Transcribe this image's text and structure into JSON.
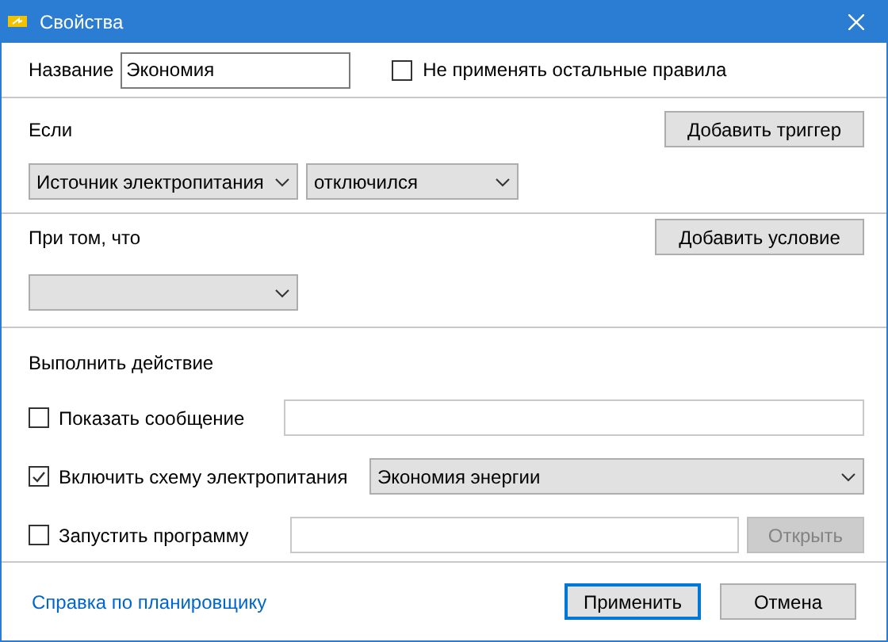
{
  "window": {
    "title": "Свойства"
  },
  "name_row": {
    "label": "Название",
    "value": "Экономия",
    "stop_rule": {
      "label": "Не применять остальные правила",
      "checked": false
    }
  },
  "trigger": {
    "heading": "Если",
    "button": "Добавить триггер",
    "selects": [
      "Источник электропитания",
      "отключился"
    ]
  },
  "condition": {
    "heading": "При том, что",
    "button": "Добавить условие"
  },
  "actions": {
    "heading": "Выполнить действие",
    "items": [
      {
        "kind": "message",
        "label": "Показать сообщение",
        "checked": false
      },
      {
        "kind": "scheme",
        "label": "Включить схему электропитания",
        "checked": true,
        "value": "Экономия энергии"
      },
      {
        "kind": "program",
        "label": "Запустить программу",
        "checked": false,
        "button": {
          "label": "Открыть",
          "disabled": true
        }
      }
    ]
  },
  "footer": {
    "link": "Справка по планировщику",
    "buttons": [
      {
        "label": "Применить",
        "default": true
      },
      {
        "label": "Отмена",
        "default": false
      }
    ]
  }
}
